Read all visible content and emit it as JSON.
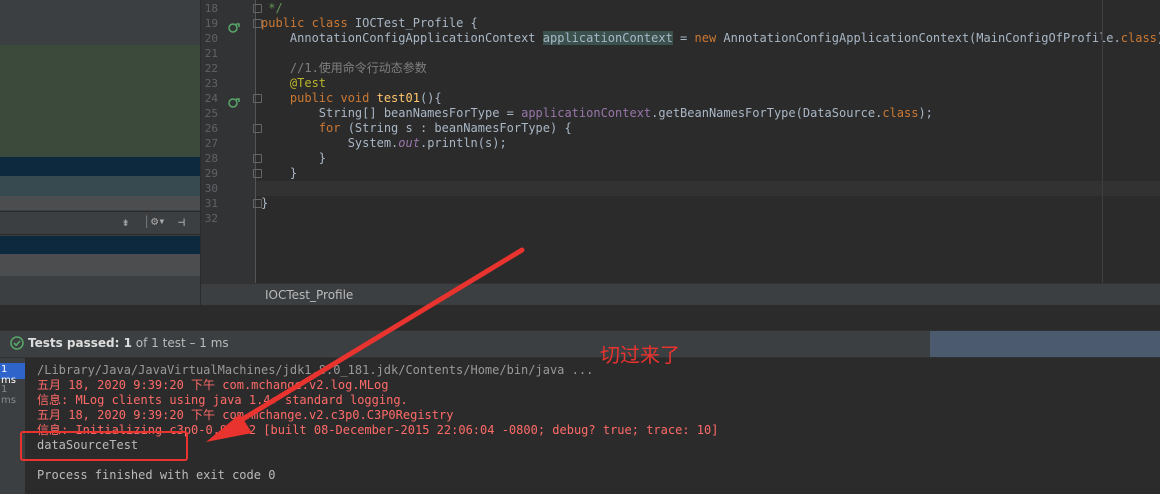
{
  "editor": {
    "lines": [
      {
        "n": "18",
        "segments": [
          {
            "t": " */",
            "c": "cm"
          }
        ]
      },
      {
        "n": "19",
        "segments": [
          {
            "t": "public class ",
            "c": "kw"
          },
          {
            "t": "IOCTest_Profile {",
            "c": ""
          }
        ]
      },
      {
        "n": "20",
        "segments": [
          {
            "t": "    AnnotationConfigApplicationContext ",
            "c": ""
          },
          {
            "t": "applicationContext",
            "c": "ctx"
          },
          {
            "t": " = ",
            "c": ""
          },
          {
            "t": "new ",
            "c": "kw"
          },
          {
            "t": "AnnotationConfigApplicationContext(MainConfigOfProfile.",
            "c": ""
          },
          {
            "t": "class",
            "c": "kw"
          },
          {
            "t": ");",
            "c": ""
          }
        ]
      },
      {
        "n": "21",
        "segments": []
      },
      {
        "n": "22",
        "segments": [
          {
            "t": "    //1.使用命令行动态参数",
            "c": "cn"
          }
        ]
      },
      {
        "n": "23",
        "segments": [
          {
            "t": "    @Test",
            "c": "an"
          }
        ]
      },
      {
        "n": "24",
        "segments": [
          {
            "t": "    public void ",
            "c": "kw"
          },
          {
            "t": "test01",
            "c": "fn"
          },
          {
            "t": "(){",
            "c": ""
          }
        ]
      },
      {
        "n": "25",
        "segments": [
          {
            "t": "        String[] beanNamesForType = ",
            "c": ""
          },
          {
            "t": "applicationContext",
            "c": "it-field"
          },
          {
            "t": ".getBeanNamesForType(DataSource.",
            "c": ""
          },
          {
            "t": "class",
            "c": "kw"
          },
          {
            "t": ");",
            "c": ""
          }
        ]
      },
      {
        "n": "26",
        "segments": [
          {
            "t": "        for ",
            "c": "kw"
          },
          {
            "t": "(String s : beanNamesForType) {",
            "c": ""
          }
        ]
      },
      {
        "n": "27",
        "segments": [
          {
            "t": "            System.",
            "c": ""
          },
          {
            "t": "out",
            "c": "it"
          },
          {
            "t": ".println(s);",
            "c": ""
          }
        ]
      },
      {
        "n": "28",
        "segments": [
          {
            "t": "        }",
            "c": ""
          }
        ]
      },
      {
        "n": "29",
        "segments": [
          {
            "t": "    }",
            "c": ""
          }
        ]
      },
      {
        "n": "30",
        "segments": []
      },
      {
        "n": "31",
        "segments": [
          {
            "t": "}",
            "c": ""
          }
        ]
      },
      {
        "n": "32",
        "segments": []
      }
    ],
    "breadcrumb": "IOCTest_Profile"
  },
  "run_panel": {
    "status_prefix": "Tests passed: ",
    "status_count": "1",
    "status_suffix": " of 1 test – 1 ms",
    "left_times": [
      "1 ms",
      "1 ms"
    ],
    "output": [
      {
        "text": "/Library/Java/JavaVirtualMachines/jdk1.8.0_181.jdk/Contents/Home/bin/java ...",
        "style": "out-gray"
      },
      {
        "text": "五月 18, 2020 9:39:20 下午 com.mchange.v2.log.MLog",
        "style": "out-err"
      },
      {
        "text": "信息: MLog clients using java 1.4+ standard logging.",
        "style": "out-err"
      },
      {
        "text": "五月 18, 2020 9:39:20 下午 com.mchange.v2.c3p0.C3P0Registry",
        "style": "out-err"
      },
      {
        "text": "信息: Initializing c3p0-0.9.5.2 [built 08-December-2015 22:06:04 -0800; debug? true; trace: 10]",
        "style": "out-err"
      },
      {
        "text": "dataSourceTest",
        "style": "out-norm"
      },
      {
        "text": "",
        "style": "out-norm"
      },
      {
        "text": "Process finished with exit code 0",
        "style": "out-norm"
      }
    ]
  },
  "annotation": {
    "text": "切过来了",
    "color": "#e8332e"
  }
}
